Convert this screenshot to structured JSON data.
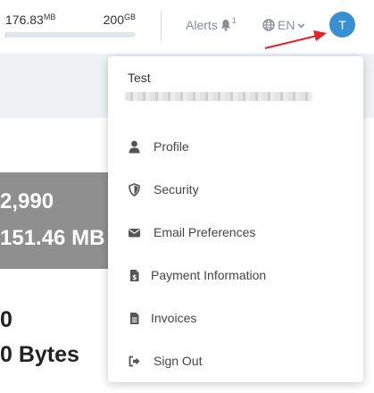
{
  "header": {
    "usage_used": "176.83",
    "usage_used_unit": "MB",
    "usage_total": "200",
    "usage_total_unit": "GB",
    "usage_fraction": 0.0009,
    "alerts_label": "Alerts",
    "alerts_count": "1",
    "language": "EN",
    "avatar_initial": "T"
  },
  "background": {
    "stat_1": "2,990",
    "stat_2": "151.46 MB",
    "stat_3": "0",
    "stat_4": "0 Bytes"
  },
  "dropdown": {
    "user_name": "Test",
    "items": [
      {
        "label": "Profile",
        "icon": "user-icon"
      },
      {
        "label": "Security",
        "icon": "shield-icon"
      },
      {
        "label": "Email Preferences",
        "icon": "envelope-icon"
      },
      {
        "label": "Payment Information",
        "icon": "invoice-dollar-icon"
      },
      {
        "label": "Invoices",
        "icon": "document-icon"
      },
      {
        "label": "Sign Out",
        "icon": "sign-out-icon"
      }
    ]
  },
  "colors": {
    "avatar": "#3a8fd3",
    "arrow": "#e0242a",
    "card": "#8f8f8f",
    "band": "#eef2f4"
  }
}
